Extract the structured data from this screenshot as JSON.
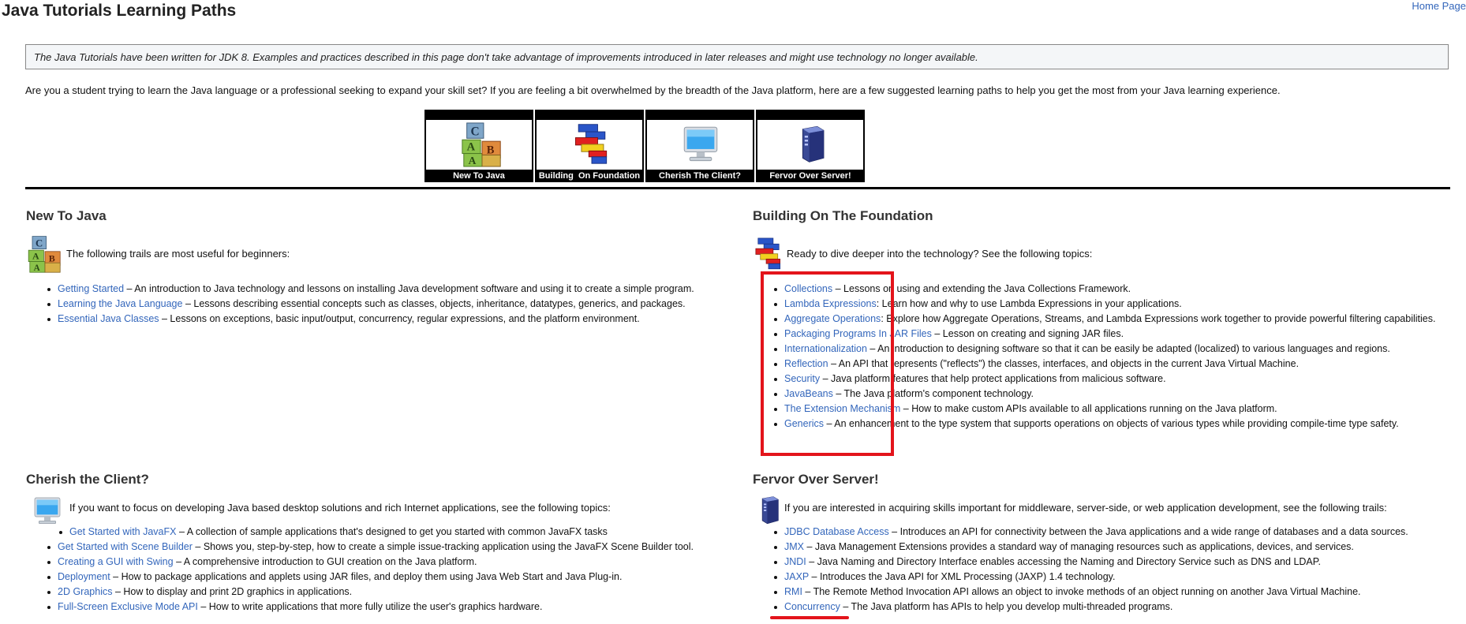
{
  "page": {
    "title": "Java Tutorials Learning Paths",
    "home_link": "Home Page"
  },
  "note": "The Java Tutorials have been written for JDK 8. Examples and practices described in this page don't take advantage of improvements introduced in later releases and might use technology no longer available.",
  "intro": "Are you a student trying to learn the Java language or a professional seeking to expand your skill set? If you are feeling a bit overwhelmed by the breadth of the Java platform, here are a few suggested learning paths to help you get the most from your Java learning experience.",
  "nav_tiles": [
    {
      "label": "New To Java",
      "icon": "abc-blocks-icon"
    },
    {
      "label": "Building  On Foundation",
      "icon": "lego-bricks-icon"
    },
    {
      "label": "Cherish The Client?",
      "icon": "monitor-icon"
    },
    {
      "label": "Fervor Over Server!",
      "icon": "server-icon"
    }
  ],
  "sections": {
    "new_to_java": {
      "title": "New To Java",
      "intro": "The following trails are most useful for beginners:",
      "icon": "abc-blocks-icon",
      "items": [
        {
          "link": "Getting Started",
          "desc": " – An introduction to Java technology and lessons on installing Java development software and using it to create a simple program."
        },
        {
          "link": "Learning the Java Language",
          "desc": " – Lessons describing essential concepts such as classes, objects, inheritance, datatypes, generics, and packages."
        },
        {
          "link": "Essential Java Classes",
          "desc": " – Lessons on exceptions, basic input/output, concurrency, regular expressions, and the platform environment."
        }
      ]
    },
    "building": {
      "title": "Building On The Foundation",
      "intro": "Ready to dive deeper into the technology? See the following topics:",
      "icon": "lego-bricks-icon",
      "items": [
        {
          "link": "Collections",
          "desc": " – Lessons on using and extending the Java Collections Framework."
        },
        {
          "link": "Lambda Expressions",
          "desc": ": Learn how and why to use Lambda Expressions in your applications."
        },
        {
          "link": "Aggregate Operations",
          "desc": ": Explore how Aggregate Operations, Streams, and Lambda Expressions work together to provide powerful filtering capabilities."
        },
        {
          "link": "Packaging Programs In JAR Files",
          "desc": " – Lesson on creating and signing JAR files."
        },
        {
          "link": "Internationalization",
          "desc": " – An introduction to designing software so that it can be easily be adapted (localized) to various languages and regions."
        },
        {
          "link": "Reflection",
          "desc": " – An API that represents (\"reflects\") the classes, interfaces, and objects in the current Java Virtual Machine."
        },
        {
          "link": "Security",
          "desc": " – Java platform features that help protect applications from malicious software."
        },
        {
          "link": "JavaBeans",
          "desc": " – The Java platform's component technology."
        },
        {
          "link": "The Extension Mechanism",
          "desc": " – How to make custom APIs available to all applications running on the Java platform."
        },
        {
          "link": "Generics",
          "desc": " – An enhancement to the type system that supports operations on objects of various types while providing compile-time type safety."
        }
      ]
    },
    "client": {
      "title": "Cherish the Client?",
      "intro": "If you want to focus on developing Java based desktop solutions and rich Internet applications, see the following topics:",
      "icon": "monitor-icon",
      "items": [
        {
          "link": "Get Started with JavaFX",
          "desc": " – A collection of sample applications that's designed to get you started with common JavaFX tasks"
        },
        {
          "link": "Get Started with Scene Builder",
          "desc": " – Shows you, step-by-step, how to create a simple issue-tracking application using the JavaFX Scene Builder tool."
        },
        {
          "link": "Creating a GUI with Swing",
          "desc": " – A comprehensive introduction to GUI creation on the Java platform."
        },
        {
          "link": "Deployment",
          "desc": " – How to package applications and applets using JAR files, and deploy them using Java Web Start and Java Plug-in."
        },
        {
          "link": "2D Graphics",
          "desc": " – How to display and print 2D graphics in applications."
        },
        {
          "link": "Full-Screen Exclusive Mode API",
          "desc": " – How to write applications that more fully utilize the user's graphics hardware."
        }
      ]
    },
    "server": {
      "title": "Fervor Over Server!",
      "intro": "If you are interested in acquiring skills important for middleware, server-side, or web application development, see the following trails:",
      "icon": "server-icon",
      "items": [
        {
          "link": "JDBC Database Access",
          "desc": " – Introduces an API for connectivity between the Java applications and a wide range of databases and a data sources."
        },
        {
          "link": "JMX",
          "desc": " – Java Management Extensions provides a standard way of managing resources such as applications, devices, and services."
        },
        {
          "link": "JNDI",
          "desc": " – Java Naming and Directory Interface enables accessing the Naming and Directory Service such as DNS and LDAP."
        },
        {
          "link": "JAXP",
          "desc": " – Introduces the Java API for XML Processing (JAXP) 1.4 technology."
        },
        {
          "link": "RMI",
          "desc": " – The Remote Method Invocation API allows an object to invoke methods of an object running on another Java Virtual Machine."
        },
        {
          "link": "Concurrency",
          "desc": " – The Java platform has APIs to help you develop multi-threaded programs."
        }
      ]
    }
  },
  "colors": {
    "link": "#3366bb",
    "highlight": "#e3141b"
  }
}
